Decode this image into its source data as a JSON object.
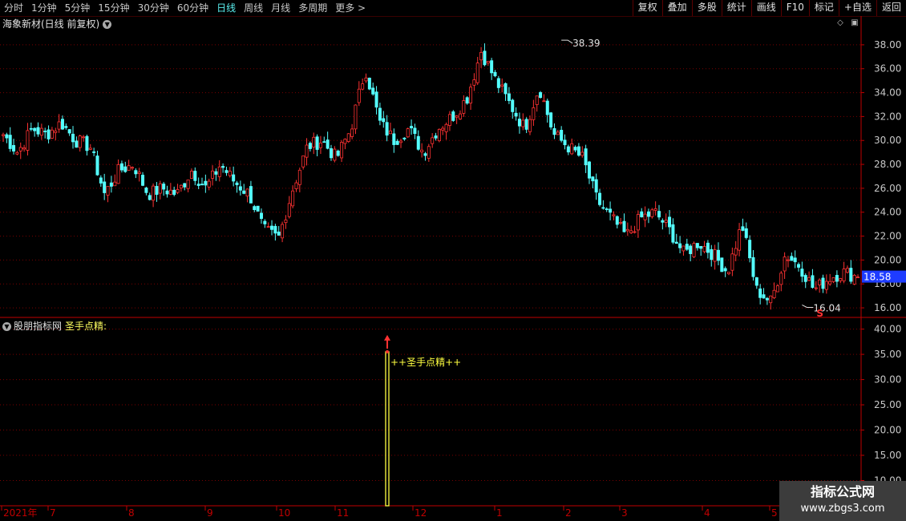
{
  "toolbar": {
    "timeframes": [
      "分时",
      "1分钟",
      "5分钟",
      "15分钟",
      "30分钟",
      "60分钟",
      "日线",
      "周线",
      "月线",
      "多周期",
      "更多 >"
    ],
    "active_timeframe": "日线",
    "right_buttons": [
      "复权",
      "叠加",
      "多股",
      "统计",
      "画线",
      "F10",
      "标记",
      "+自选",
      "返回"
    ]
  },
  "main_panel": {
    "title": "海象新材(日线 前复权)",
    "high_marker": "38.39",
    "low_marker": "16.04",
    "current_price": "18.58",
    "signal_mark": "S"
  },
  "indicator_panel": {
    "site": "股朋指标网",
    "name": "圣手点精:",
    "signal_text": "++圣手点精++"
  },
  "watermark": {
    "line1": "指标公式网",
    "line2": "www.zbgs3.com"
  },
  "colors": {
    "up": "#ff3232",
    "down": "#54ffff",
    "grid": "#7a0000",
    "axis": "#c00000",
    "indicator": "#ffff40"
  },
  "chart_data": [
    {
      "type": "candlestick",
      "title": "海象新材(日线 前复权)",
      "y_ticks": [
        16.0,
        18.0,
        20.0,
        22.0,
        24.0,
        26.0,
        28.0,
        30.0,
        32.0,
        34.0,
        36.0,
        38.0
      ],
      "ylim": [
        15.2,
        39.2
      ],
      "x_labels": [
        "2021年",
        "7",
        "8",
        "9",
        "10",
        "11",
        "12",
        "1",
        "2",
        "3",
        "4",
        "5"
      ],
      "annotations": [
        {
          "label": "38.39",
          "type": "high"
        },
        {
          "label": "16.04",
          "type": "low"
        }
      ],
      "last_price": 18.58,
      "price_path_approx": [
        30.5,
        29.0,
        31.0,
        30.5,
        31.5,
        30.0,
        29.5,
        25.5,
        27.5,
        28.0,
        25.5,
        26.0,
        25.5,
        27.5,
        26.0,
        28.0,
        26.5,
        25.5,
        22.5,
        21.8,
        26.0,
        29.5,
        30.0,
        28.5,
        31.0,
        36.0,
        31.5,
        30.0,
        31.0,
        29.0,
        31.0,
        32.0,
        33.5,
        37.5,
        35.0,
        33.0,
        31.0,
        34.5,
        30.5,
        29.5,
        28.5,
        25.0,
        23.5,
        22.0,
        23.5,
        24.0,
        22.5,
        20.5,
        21.5,
        20.5,
        19.0,
        23.0,
        17.5,
        16.5,
        20.5,
        19.5,
        17.5,
        18.5,
        19.0,
        18.58
      ]
    },
    {
      "type": "bar",
      "title": "圣手点精",
      "y_ticks": [
        10.0,
        15.0,
        20.0,
        25.0,
        30.0,
        35.0,
        40.0
      ],
      "ylim": [
        5.0,
        42.0
      ],
      "signals": [
        {
          "x_label": "11",
          "value": 35.5,
          "label": "++圣手点精++"
        }
      ]
    }
  ]
}
